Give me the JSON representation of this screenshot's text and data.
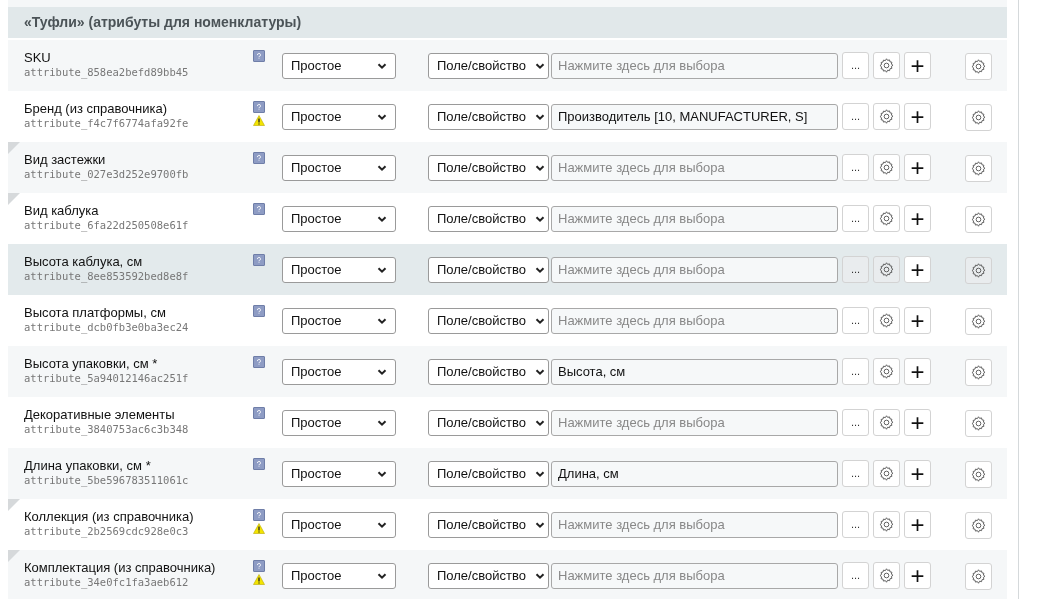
{
  "section": {
    "title": "«Туфли» (атрибуты для номенклатуры)"
  },
  "rows": [
    {
      "name": "SKU",
      "code": "attribute_858ea2befd89bb45",
      "warning": false,
      "corner_mark": false,
      "highlighted": false,
      "type": "Простое",
      "source": "Поле/свойство",
      "placeholder": "Нажмите здесь для выбора",
      "more": "...",
      "plus": "+"
    },
    {
      "name": "Бренд (из справочника)",
      "code": "attribute_f4c7f6774afa92fe",
      "warning": true,
      "corner_mark": false,
      "highlighted": false,
      "type": "Простое",
      "source": "Поле/свойство",
      "value": "Производитель [10, MANUFACTURER, S]",
      "more": "...",
      "plus": "+"
    },
    {
      "name": "Вид застежки",
      "code": "attribute_027e3d252e9700fb",
      "warning": false,
      "corner_mark": true,
      "highlighted": false,
      "type": "Простое",
      "source": "Поле/свойство",
      "placeholder": "Нажмите здесь для выбора",
      "more": "...",
      "plus": "+"
    },
    {
      "name": "Вид каблука",
      "code": "attribute_6fa22d250508e61f",
      "warning": false,
      "corner_mark": true,
      "highlighted": false,
      "type": "Простое",
      "source": "Поле/свойство",
      "placeholder": "Нажмите здесь для выбора",
      "more": "...",
      "plus": "+"
    },
    {
      "name": "Высота каблука, см",
      "code": "attribute_8ee853592bed8e8f",
      "warning": false,
      "corner_mark": false,
      "highlighted": true,
      "type": "Простое",
      "source": "Поле/свойство",
      "placeholder": "Нажмите здесь для выбора",
      "more": "...",
      "plus": "+"
    },
    {
      "name": "Высота платформы, см",
      "code": "attribute_dcb0fb3e0ba3ec24",
      "warning": false,
      "corner_mark": false,
      "highlighted": false,
      "type": "Простое",
      "source": "Поле/свойство",
      "placeholder": "Нажмите здесь для выбора",
      "more": "...",
      "plus": "+"
    },
    {
      "name": "Высота упаковки, см *",
      "code": "attribute_5a94012146ac251f",
      "warning": false,
      "corner_mark": false,
      "highlighted": false,
      "type": "Простое",
      "source": "Поле/свойство",
      "value": "Высота, см",
      "more": "...",
      "plus": "+"
    },
    {
      "name": "Декоративные элементы",
      "code": "attribute_3840753ac6c3b348",
      "warning": false,
      "corner_mark": false,
      "highlighted": false,
      "type": "Простое",
      "source": "Поле/свойство",
      "placeholder": "Нажмите здесь для выбора",
      "more": "...",
      "plus": "+"
    },
    {
      "name": "Длина упаковки, см *",
      "code": "attribute_5be596783511061c",
      "warning": false,
      "corner_mark": false,
      "highlighted": false,
      "type": "Простое",
      "source": "Поле/свойство",
      "value": "Длина, см",
      "more": "...",
      "plus": "+"
    },
    {
      "name": "Коллекция (из справочника)",
      "code": "attribute_2b2569cdc928e0c3",
      "warning": true,
      "corner_mark": true,
      "highlighted": false,
      "type": "Простое",
      "source": "Поле/свойство",
      "placeholder": "Нажмите здесь для выбора",
      "more": "...",
      "plus": "+"
    },
    {
      "name": "Комплектация (из справочника)",
      "code": "attribute_34e0fc1fa3aeb612",
      "warning": true,
      "corner_mark": true,
      "highlighted": false,
      "type": "Простое",
      "source": "Поле/свойство",
      "placeholder": "Нажмите здесь для выбора",
      "more": "...",
      "plus": "+"
    }
  ]
}
